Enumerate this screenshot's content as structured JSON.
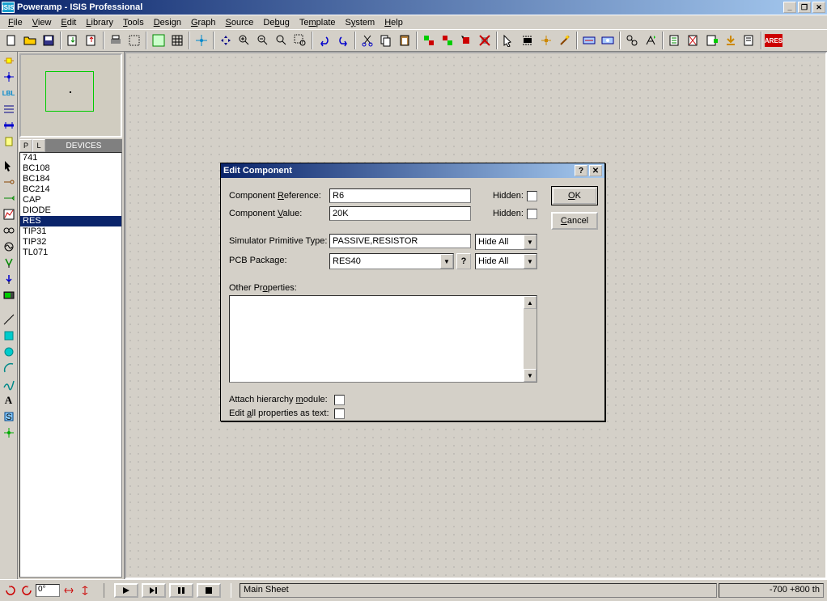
{
  "title": "Poweramp - ISIS Professional",
  "menu": [
    "File",
    "View",
    "Edit",
    "Library",
    "Tools",
    "Design",
    "Graph",
    "Source",
    "Debug",
    "Template",
    "System",
    "Help"
  ],
  "menuAccel": [
    "F",
    "V",
    "E",
    "L",
    "T",
    "D",
    "G",
    "S",
    "b",
    "m",
    "y",
    "H"
  ],
  "sidebar": {
    "tabP": "P",
    "tabL": "L",
    "header": "DEVICES",
    "items": [
      "741",
      "BC108",
      "BC184",
      "BC214",
      "CAP",
      "DIODE",
      "RES",
      "TIP31",
      "TIP32",
      "TL071"
    ],
    "selected": "RES"
  },
  "bottom": {
    "angle": "0°",
    "status": "Main Sheet",
    "coords": "-700       +800    th"
  },
  "dialog": {
    "title": "Edit Component",
    "lblRef": "Component Reference:",
    "valRef": "R6",
    "lblVal": "Component Value:",
    "valVal": "20K",
    "lblHidden": "Hidden:",
    "lblSim": "Simulator Primitive Type:",
    "valSim": "PASSIVE,RESISTOR",
    "optSim": "Hide All",
    "lblPkg": "PCB Package:",
    "valPkg": "RES40",
    "optPkg": "Hide All",
    "lblOther": "Other Properties:",
    "lblAttach": "Attach hierarchy module:",
    "lblEditAll": "Edit all properties as text:",
    "btnOK": "OK",
    "btnCancel": "Cancel",
    "btnHelp": "?",
    "btnClose": "✕"
  },
  "toolbar": {
    "ares": "ARES"
  }
}
